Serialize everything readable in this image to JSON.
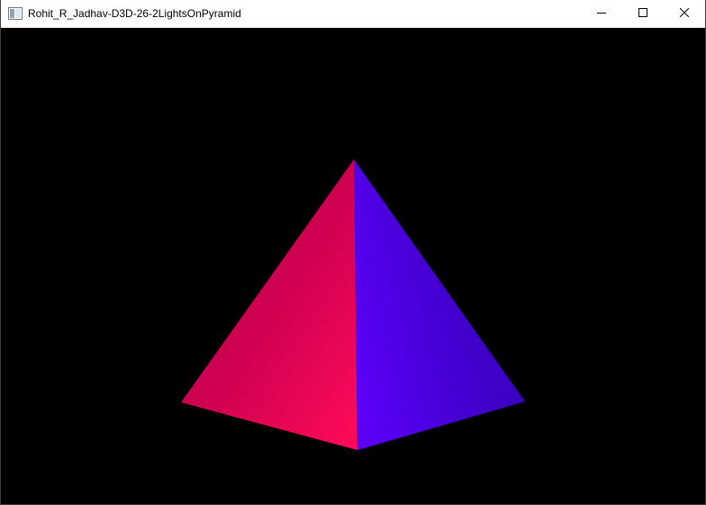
{
  "window": {
    "title": "Rohit_R_Jadhav-D3D-26-2LightsOnPyramid",
    "app_icon": "window-app-icon",
    "controls": {
      "minimize_icon": "minimize-icon",
      "maximize_icon": "maximize-icon",
      "close_icon": "close-icon"
    }
  },
  "scene": {
    "background_color": "#000000",
    "object": "pyramid",
    "left_face": {
      "colors": [
        "#c2004e",
        "#d70052",
        "#fa0a58"
      ]
    },
    "right_face": {
      "colors": [
        "#4a00d2",
        "#3c00c8",
        "#5a00f5"
      ]
    }
  }
}
